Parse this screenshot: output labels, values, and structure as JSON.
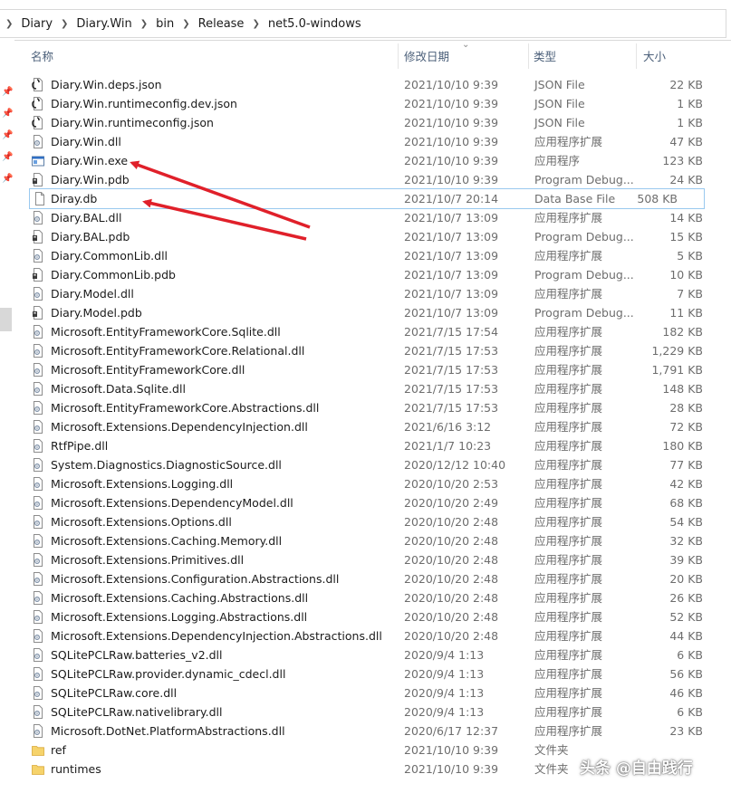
{
  "breadcrumb": [
    "Diary",
    "Diary.Win",
    "bin",
    "Release",
    "net5.0-windows"
  ],
  "columns": {
    "name": "名称",
    "date": "修改日期",
    "type": "类型",
    "size": "大小"
  },
  "colors": {
    "arrow": "#e0202a",
    "header_text": "#4c607a",
    "selection_border": "#99c9ef"
  },
  "files": [
    {
      "name": "Diary.Win.deps.json",
      "date": "2021/10/10 9:39",
      "type": "JSON File",
      "size": "22 KB",
      "icon": "json-file-icon"
    },
    {
      "name": "Diary.Win.runtimeconfig.dev.json",
      "date": "2021/10/10 9:39",
      "type": "JSON File",
      "size": "1 KB",
      "icon": "json-file-icon"
    },
    {
      "name": "Diary.Win.runtimeconfig.json",
      "date": "2021/10/10 9:39",
      "type": "JSON File",
      "size": "1 KB",
      "icon": "json-file-icon"
    },
    {
      "name": "Diary.Win.dll",
      "date": "2021/10/10 9:39",
      "type": "应用程序扩展",
      "size": "47 KB",
      "icon": "dll-file-icon"
    },
    {
      "name": "Diary.Win.exe",
      "date": "2021/10/10 9:39",
      "type": "应用程序",
      "size": "123 KB",
      "icon": "exe-file-icon"
    },
    {
      "name": "Diary.Win.pdb",
      "date": "2021/10/10 9:39",
      "type": "Program Debug...",
      "size": "24 KB",
      "icon": "pdb-file-icon"
    },
    {
      "name": "Diray.db",
      "date": "2021/10/7 20:14",
      "type": "Data Base File",
      "size": "508 KB",
      "icon": "db-file-icon",
      "selected": true
    },
    {
      "name": "Diary.BAL.dll",
      "date": "2021/10/7 13:09",
      "type": "应用程序扩展",
      "size": "14 KB",
      "icon": "dll-file-icon"
    },
    {
      "name": "Diary.BAL.pdb",
      "date": "2021/10/7 13:09",
      "type": "Program Debug...",
      "size": "15 KB",
      "icon": "pdb-file-icon"
    },
    {
      "name": "Diary.CommonLib.dll",
      "date": "2021/10/7 13:09",
      "type": "应用程序扩展",
      "size": "5 KB",
      "icon": "dll-file-icon"
    },
    {
      "name": "Diary.CommonLib.pdb",
      "date": "2021/10/7 13:09",
      "type": "Program Debug...",
      "size": "10 KB",
      "icon": "pdb-file-icon"
    },
    {
      "name": "Diary.Model.dll",
      "date": "2021/10/7 13:09",
      "type": "应用程序扩展",
      "size": "7 KB",
      "icon": "dll-file-icon"
    },
    {
      "name": "Diary.Model.pdb",
      "date": "2021/10/7 13:09",
      "type": "Program Debug...",
      "size": "11 KB",
      "icon": "pdb-file-icon"
    },
    {
      "name": "Microsoft.EntityFrameworkCore.Sqlite.dll",
      "date": "2021/7/15 17:54",
      "type": "应用程序扩展",
      "size": "182 KB",
      "icon": "dll-file-icon"
    },
    {
      "name": "Microsoft.EntityFrameworkCore.Relational.dll",
      "date": "2021/7/15 17:53",
      "type": "应用程序扩展",
      "size": "1,229 KB",
      "icon": "dll-file-icon"
    },
    {
      "name": "Microsoft.EntityFrameworkCore.dll",
      "date": "2021/7/15 17:53",
      "type": "应用程序扩展",
      "size": "1,791 KB",
      "icon": "dll-file-icon"
    },
    {
      "name": "Microsoft.Data.Sqlite.dll",
      "date": "2021/7/15 17:53",
      "type": "应用程序扩展",
      "size": "148 KB",
      "icon": "dll-file-icon"
    },
    {
      "name": "Microsoft.EntityFrameworkCore.Abstractions.dll",
      "date": "2021/7/15 17:53",
      "type": "应用程序扩展",
      "size": "28 KB",
      "icon": "dll-file-icon"
    },
    {
      "name": "Microsoft.Extensions.DependencyInjection.dll",
      "date": "2021/6/16 3:12",
      "type": "应用程序扩展",
      "size": "72 KB",
      "icon": "dll-file-icon"
    },
    {
      "name": "RtfPipe.dll",
      "date": "2021/1/7 10:23",
      "type": "应用程序扩展",
      "size": "180 KB",
      "icon": "dll-file-icon"
    },
    {
      "name": "System.Diagnostics.DiagnosticSource.dll",
      "date": "2020/12/12 10:40",
      "type": "应用程序扩展",
      "size": "77 KB",
      "icon": "dll-file-icon"
    },
    {
      "name": "Microsoft.Extensions.Logging.dll",
      "date": "2020/10/20 2:53",
      "type": "应用程序扩展",
      "size": "42 KB",
      "icon": "dll-file-icon"
    },
    {
      "name": "Microsoft.Extensions.DependencyModel.dll",
      "date": "2020/10/20 2:49",
      "type": "应用程序扩展",
      "size": "68 KB",
      "icon": "dll-file-icon"
    },
    {
      "name": "Microsoft.Extensions.Options.dll",
      "date": "2020/10/20 2:48",
      "type": "应用程序扩展",
      "size": "54 KB",
      "icon": "dll-file-icon"
    },
    {
      "name": "Microsoft.Extensions.Caching.Memory.dll",
      "date": "2020/10/20 2:48",
      "type": "应用程序扩展",
      "size": "32 KB",
      "icon": "dll-file-icon"
    },
    {
      "name": "Microsoft.Extensions.Primitives.dll",
      "date": "2020/10/20 2:48",
      "type": "应用程序扩展",
      "size": "39 KB",
      "icon": "dll-file-icon"
    },
    {
      "name": "Microsoft.Extensions.Configuration.Abstractions.dll",
      "date": "2020/10/20 2:48",
      "type": "应用程序扩展",
      "size": "20 KB",
      "icon": "dll-file-icon"
    },
    {
      "name": "Microsoft.Extensions.Caching.Abstractions.dll",
      "date": "2020/10/20 2:48",
      "type": "应用程序扩展",
      "size": "26 KB",
      "icon": "dll-file-icon"
    },
    {
      "name": "Microsoft.Extensions.Logging.Abstractions.dll",
      "date": "2020/10/20 2:48",
      "type": "应用程序扩展",
      "size": "52 KB",
      "icon": "dll-file-icon"
    },
    {
      "name": "Microsoft.Extensions.DependencyInjection.Abstractions.dll",
      "date": "2020/10/20 2:48",
      "type": "应用程序扩展",
      "size": "44 KB",
      "icon": "dll-file-icon"
    },
    {
      "name": "SQLitePCLRaw.batteries_v2.dll",
      "date": "2020/9/4 1:13",
      "type": "应用程序扩展",
      "size": "6 KB",
      "icon": "dll-file-icon"
    },
    {
      "name": "SQLitePCLRaw.provider.dynamic_cdecl.dll",
      "date": "2020/9/4 1:13",
      "type": "应用程序扩展",
      "size": "56 KB",
      "icon": "dll-file-icon"
    },
    {
      "name": "SQLitePCLRaw.core.dll",
      "date": "2020/9/4 1:13",
      "type": "应用程序扩展",
      "size": "46 KB",
      "icon": "dll-file-icon"
    },
    {
      "name": "SQLitePCLRaw.nativelibrary.dll",
      "date": "2020/9/4 1:13",
      "type": "应用程序扩展",
      "size": "6 KB",
      "icon": "dll-file-icon"
    },
    {
      "name": "Microsoft.DotNet.PlatformAbstractions.dll",
      "date": "2020/6/17 12:37",
      "type": "应用程序扩展",
      "size": "23 KB",
      "icon": "dll-file-icon"
    },
    {
      "name": "ref",
      "date": "2021/10/10 9:39",
      "type": "文件夹",
      "size": "",
      "icon": "folder-icon"
    },
    {
      "name": "runtimes",
      "date": "2021/10/10 9:39",
      "type": "文件夹",
      "size": "",
      "icon": "folder-icon"
    }
  ],
  "watermark": "头条 @自由践行"
}
